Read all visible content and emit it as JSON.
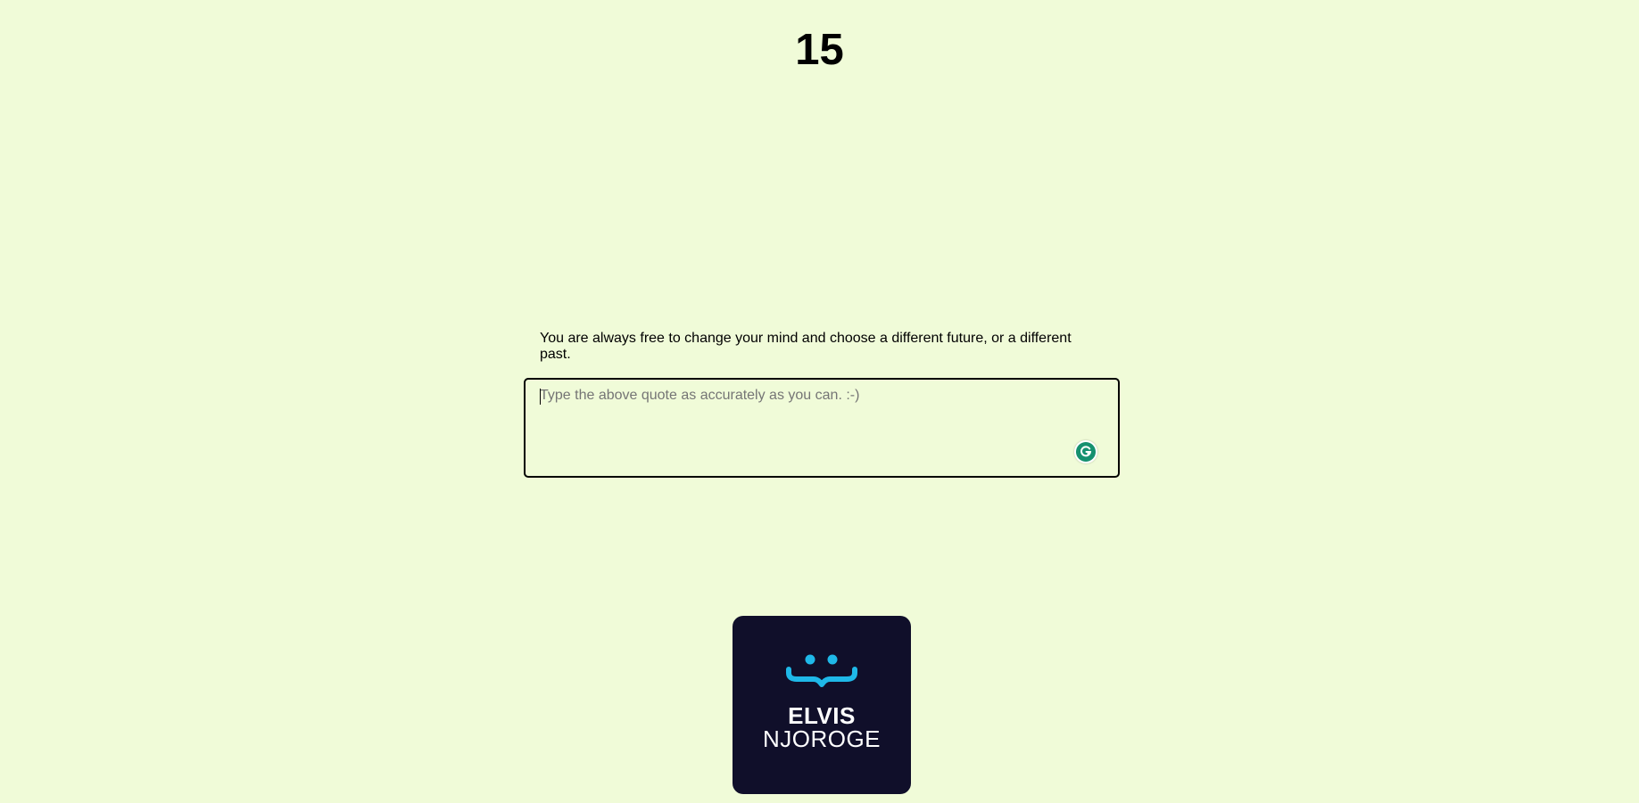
{
  "timer": {
    "value": "15"
  },
  "quote": {
    "text": "You are always free to change your mind and choose a different future, or a different past."
  },
  "typing_input": {
    "value": "",
    "placeholder": "Type the above quote as accurately as you can. :-)"
  },
  "grammarly": {
    "icon": "grammarly-icon",
    "color": "#15906f"
  },
  "logo": {
    "line1": "ELVIS",
    "line2": "NJOROGE",
    "accent_color": "#1fb8e8",
    "background_color": "#100f2a"
  },
  "colors": {
    "page_background": "#f0fbd8"
  }
}
